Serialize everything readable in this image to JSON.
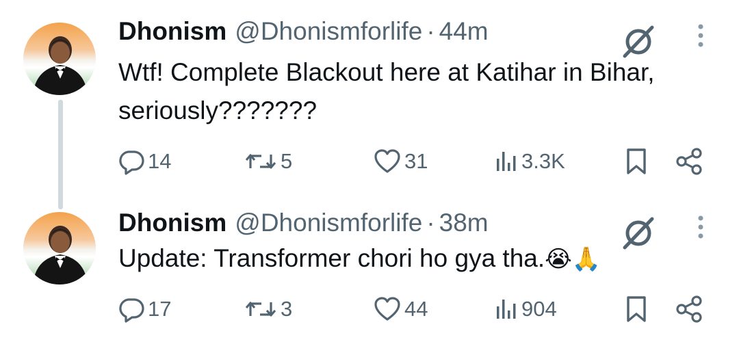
{
  "tweets": [
    {
      "name": "Dhonism",
      "handle": "@Dhonismforlife",
      "separator": "·",
      "time": "44m",
      "text": "Wtf! Complete Blackout here at Katihar in Bihar, seriously???????",
      "replies": "14",
      "reposts": "5",
      "likes": "31",
      "views": "3.3K"
    },
    {
      "name": "Dhonism",
      "handle": "@Dhonismforlife",
      "separator": "·",
      "time": "38m",
      "text": "Update: Transformer chori ho gya tha.",
      "emoji": "😭🙏",
      "replies": "17",
      "reposts": "3",
      "likes": "44",
      "views": "904"
    }
  ],
  "icons": {
    "avatar": "profile-photo",
    "grok": "grok-slash-circle-icon",
    "more": "more-vertical-icon",
    "reply": "reply-bubble-icon",
    "retweet": "repost-arrows-icon",
    "like": "heart-icon",
    "views": "bar-chart-icon",
    "bookmark": "bookmark-icon",
    "share": "share-nodes-icon"
  },
  "colors": {
    "text": "#0f1419",
    "secondary": "#536471",
    "thread_line": "#cfd9de"
  }
}
